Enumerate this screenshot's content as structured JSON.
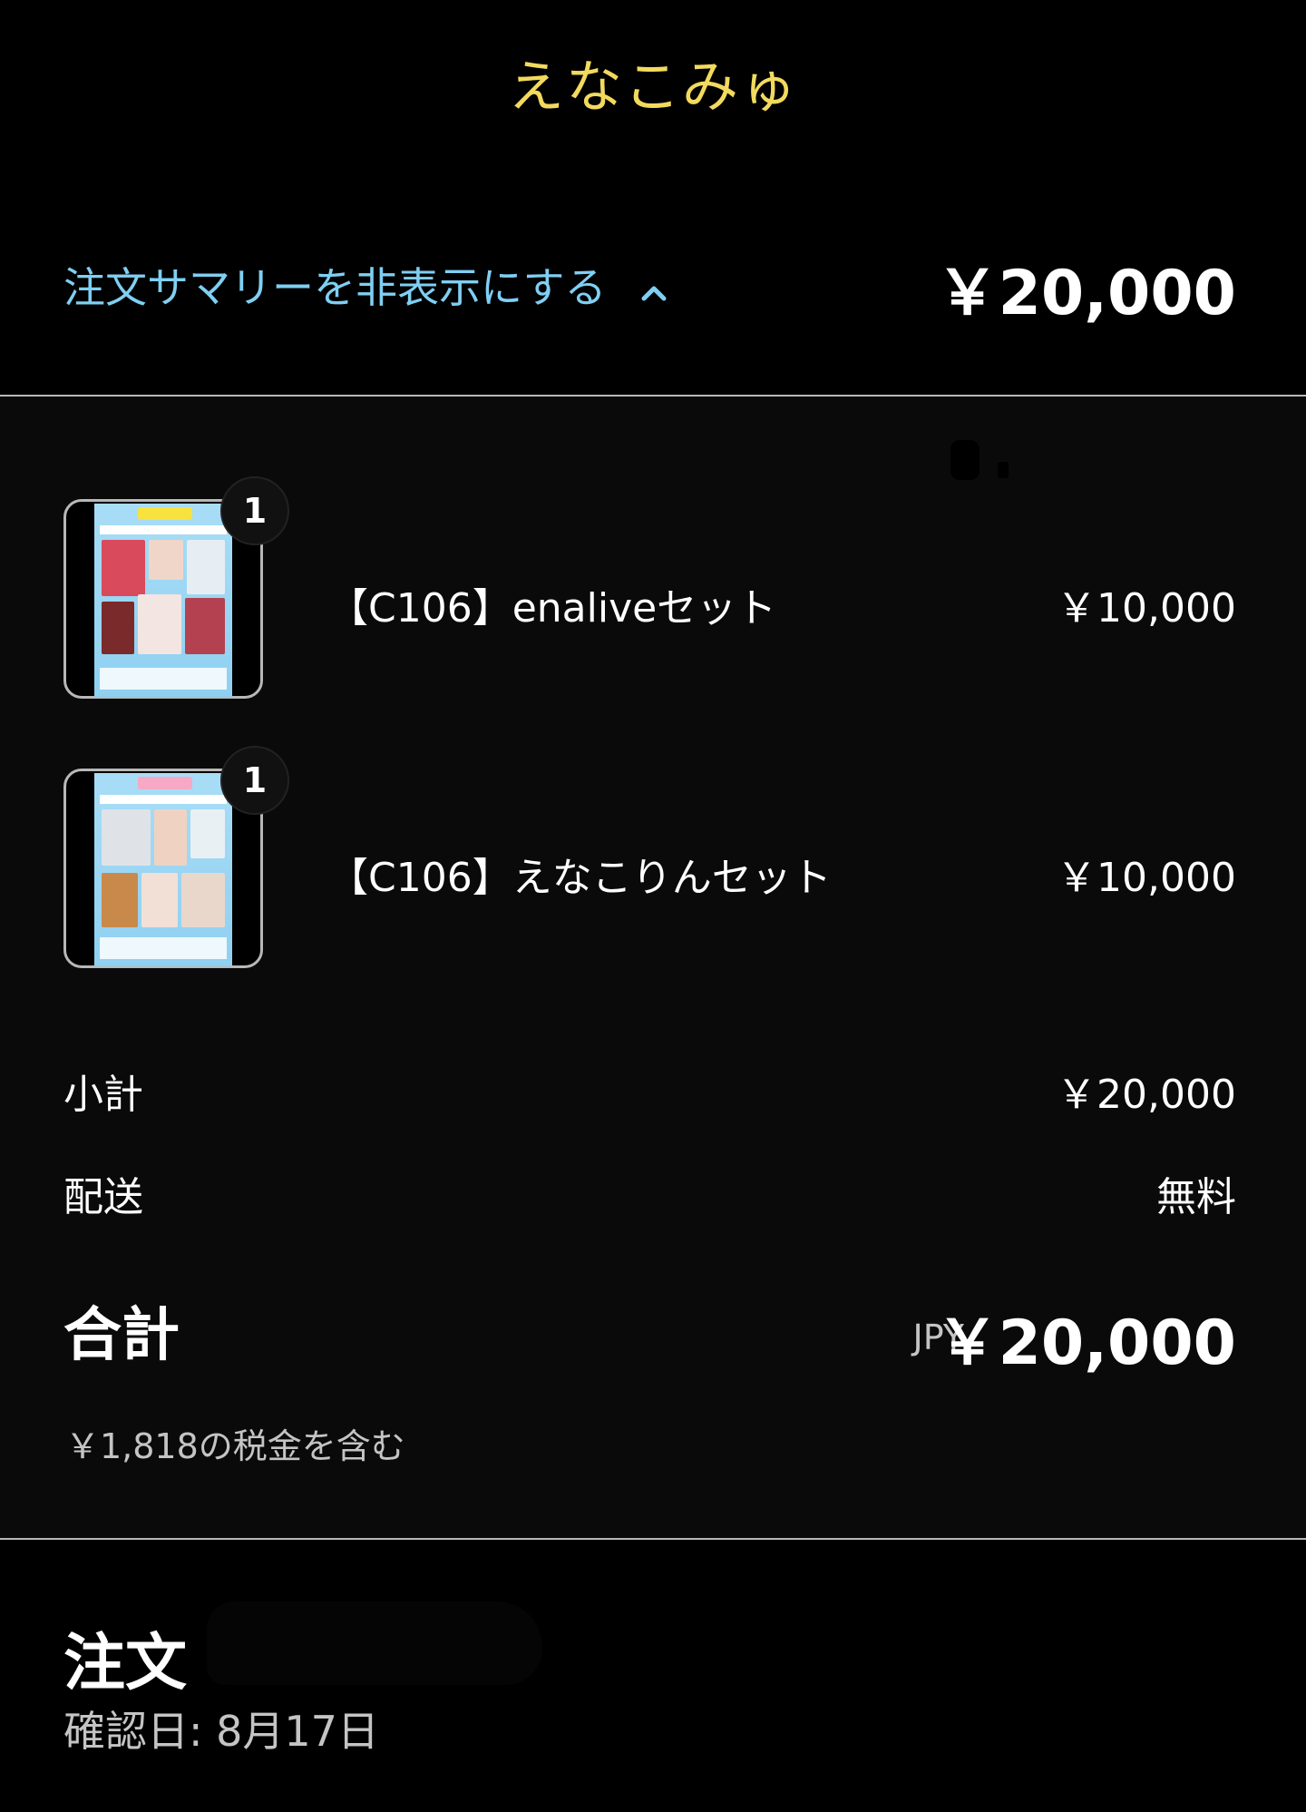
{
  "header": {
    "store_name": "えなこみゅ"
  },
  "summary_bar": {
    "toggle_label": "注文サマリーを非表示にする",
    "total": "￥20,000"
  },
  "items": [
    {
      "name": "【C106】enaliveセット",
      "price": "￥10,000",
      "quantity": "1",
      "image": "enalive-set-thumbnail"
    },
    {
      "name": "【C106】えなこりんセット",
      "price": "￥10,000",
      "quantity": "1",
      "image": "enakorin-set-thumbnail"
    }
  ],
  "lines": {
    "subtotal_label": "小計",
    "subtotal_value": "￥20,000",
    "shipping_label": "配送",
    "shipping_value": "無料"
  },
  "total": {
    "label": "合計",
    "currency": "JPY",
    "amount": "￥20,000",
    "tax_note": "￥1,818の税金を含む"
  },
  "order": {
    "title": "注文",
    "confirmed": "確認日: 8月17日"
  },
  "colors": {
    "store_name": "#f2da5e",
    "link": "#7fcff3",
    "muted_text": "#c4c4c4",
    "divider": "#b8b8b8"
  },
  "icons": {
    "toggle": "chevron-up-icon"
  }
}
